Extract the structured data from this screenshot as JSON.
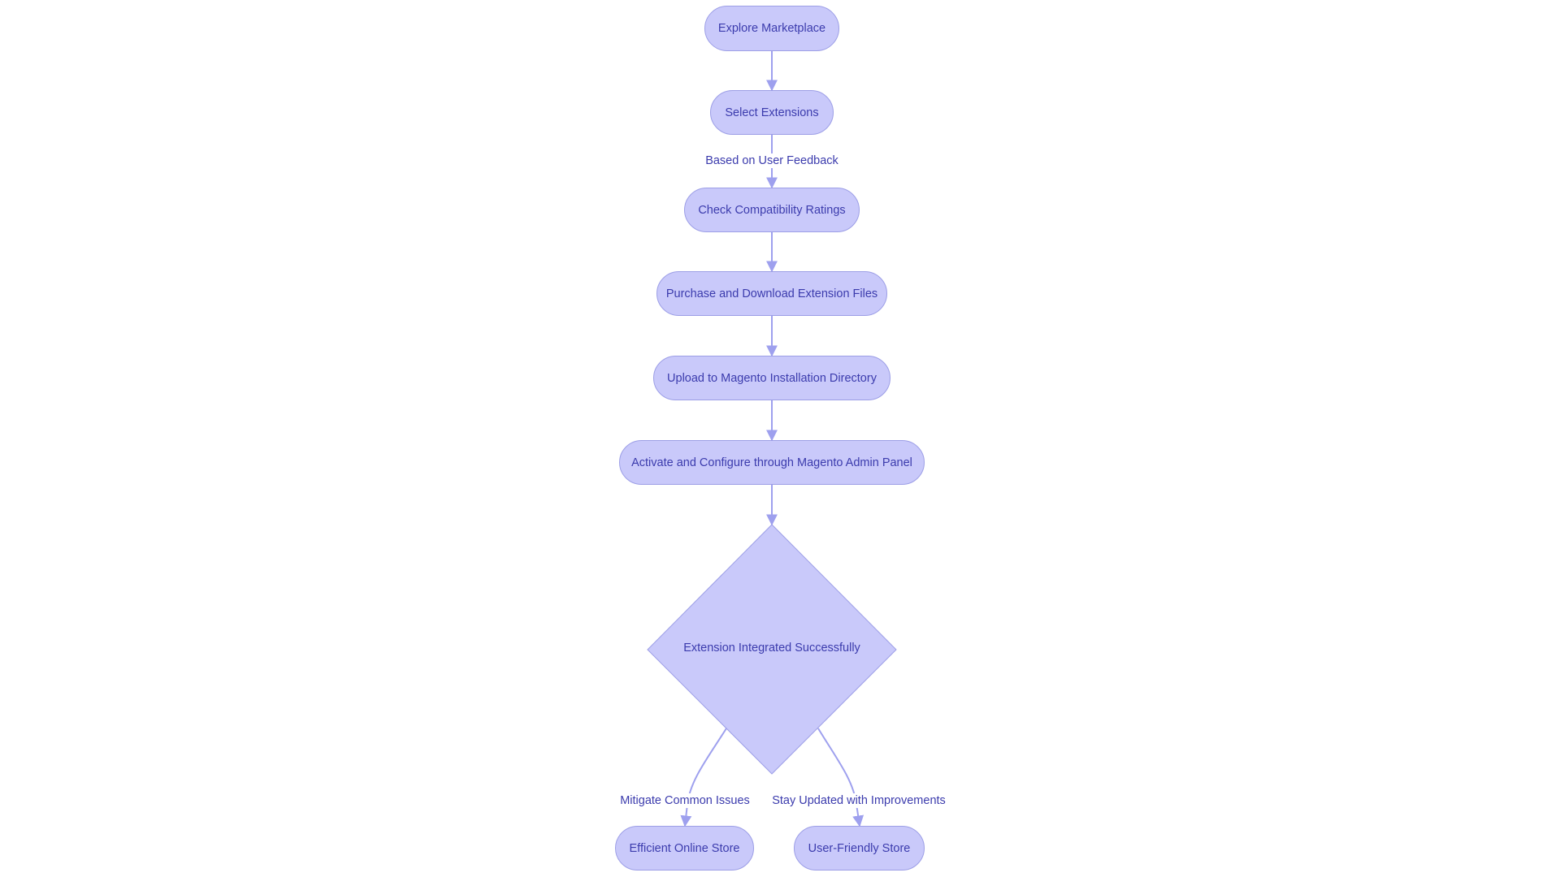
{
  "diagram": {
    "type": "flowchart",
    "direction": "top-down",
    "colors": {
      "node_fill": "#c9c9fa",
      "node_border": "#9c9ee6",
      "text": "#3b3bad",
      "edge": "#9ea0ee",
      "background": "#ffffff"
    },
    "nodes": [
      {
        "id": "A",
        "label": "Explore Marketplace",
        "shape": "stadium"
      },
      {
        "id": "B",
        "label": "Select Extensions",
        "shape": "stadium"
      },
      {
        "id": "C",
        "label": "Check Compatibility Ratings",
        "shape": "stadium"
      },
      {
        "id": "D",
        "label": "Purchase and Download Extension Files",
        "shape": "stadium"
      },
      {
        "id": "E",
        "label": "Upload to Magento Installation Directory",
        "shape": "stadium"
      },
      {
        "id": "F",
        "label": "Activate and Configure through Magento Admin Panel",
        "shape": "stadium"
      },
      {
        "id": "G",
        "label": "Extension Integrated Successfully",
        "shape": "diamond"
      },
      {
        "id": "H",
        "label": "Efficient Online Store",
        "shape": "stadium"
      },
      {
        "id": "I",
        "label": "User-Friendly Store",
        "shape": "stadium"
      }
    ],
    "edges": [
      {
        "from": "A",
        "to": "B",
        "label": ""
      },
      {
        "from": "B",
        "to": "C",
        "label": "Based on User Feedback"
      },
      {
        "from": "C",
        "to": "D",
        "label": ""
      },
      {
        "from": "D",
        "to": "E",
        "label": ""
      },
      {
        "from": "E",
        "to": "F",
        "label": ""
      },
      {
        "from": "F",
        "to": "G",
        "label": ""
      },
      {
        "from": "G",
        "to": "H",
        "label": "Mitigate Common Issues"
      },
      {
        "from": "G",
        "to": "I",
        "label": "Stay Updated with Improvements"
      }
    ]
  }
}
